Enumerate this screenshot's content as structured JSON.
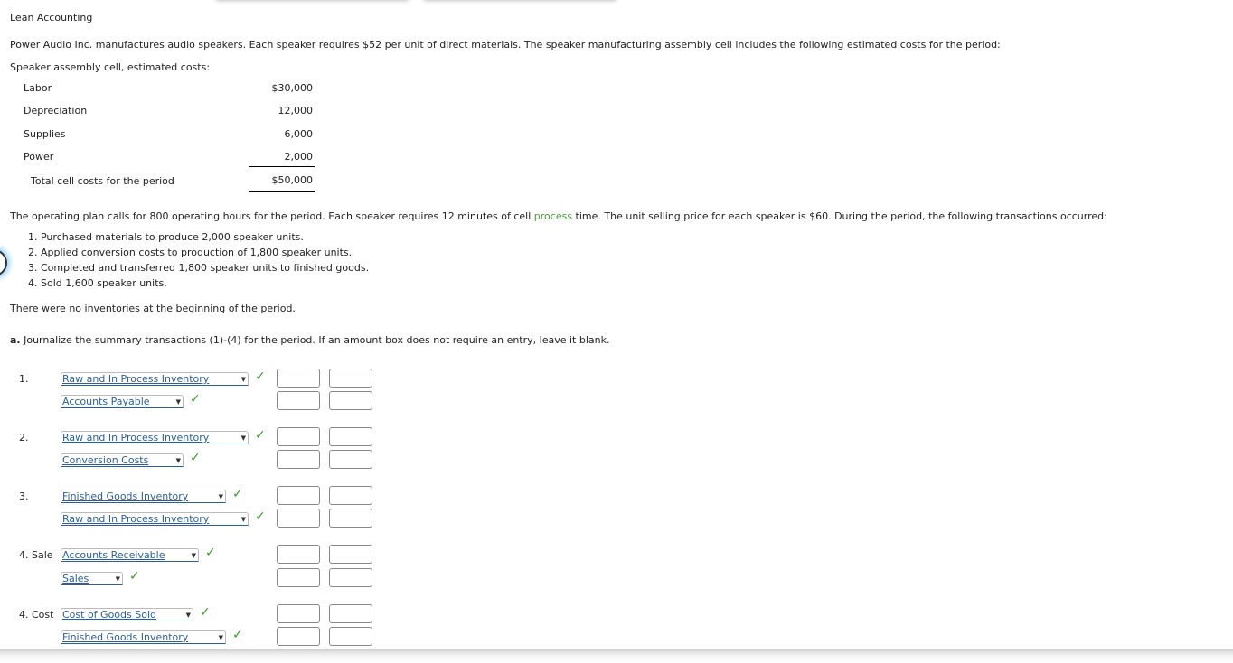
{
  "section_title": "Lean Accounting",
  "intro": "Power Audio Inc. manufactures audio speakers. Each speaker requires $52 per unit of direct materials. The speaker manufacturing assembly cell includes the following estimated costs for the period:",
  "costs_label": "Speaker assembly cell, estimated costs:",
  "costs": [
    {
      "name": "Labor",
      "value": "$30,000"
    },
    {
      "name": "Depreciation",
      "value": "12,000"
    },
    {
      "name": "Supplies",
      "value": "6,000"
    },
    {
      "name": "Power",
      "value": "2,000"
    }
  ],
  "total": {
    "name": "Total cell costs for the period",
    "value": "$50,000"
  },
  "plan": {
    "before": "The operating plan calls for 800 operating hours for the period. Each speaker requires 12 minutes of cell ",
    "link": "process",
    "after": " time. The unit selling price for each speaker is $60. During the period, the following transactions occurred:"
  },
  "transactions": [
    "1. Purchased materials to produce 2,000 speaker units.",
    "2. Applied conversion costs to production of 1,800 speaker units.",
    "3. Completed and transferred 1,800 speaker units to finished goods.",
    "4. Sold 1,600 speaker units."
  ],
  "no_inventories": "There were no inventories at the beginning of the period.",
  "instruction": {
    "prefix": "a.",
    "text": " Journalize the summary transactions (1)-(4) for the period. If an amount box does not require an entry, leave it blank."
  },
  "journal": [
    {
      "label": "1.",
      "lines": [
        {
          "account": "Raw and In Process Inventory",
          "debit": "",
          "credit": "",
          "status": "correct"
        },
        {
          "account": "Accounts Payable",
          "debit": "",
          "credit": "",
          "status": "correct"
        }
      ]
    },
    {
      "label": "2.",
      "lines": [
        {
          "account": "Raw and In Process Inventory",
          "debit": "",
          "credit": "",
          "status": "correct"
        },
        {
          "account": "Conversion Costs",
          "debit": "",
          "credit": "",
          "status": "correct"
        }
      ]
    },
    {
      "label": "3.",
      "lines": [
        {
          "account": "Finished Goods Inventory",
          "debit": "",
          "credit": "",
          "status": "correct"
        },
        {
          "account": "Raw and In Process Inventory",
          "debit": "",
          "credit": "",
          "status": "correct"
        }
      ]
    },
    {
      "label": "4. Sale",
      "lines": [
        {
          "account": "Accounts Receivable",
          "debit": "",
          "credit": "",
          "status": "correct"
        },
        {
          "account": "Sales",
          "debit": "",
          "credit": "",
          "status": "correct"
        }
      ]
    },
    {
      "label": "4. Cost",
      "lines": [
        {
          "account": "Cost of Goods Sold",
          "debit": "",
          "credit": "",
          "status": "correct"
        },
        {
          "account": "Finished Goods Inventory",
          "debit": "",
          "credit": "",
          "status": "correct"
        }
      ]
    }
  ],
  "icons": {
    "check": "✓",
    "caret": "▼"
  }
}
